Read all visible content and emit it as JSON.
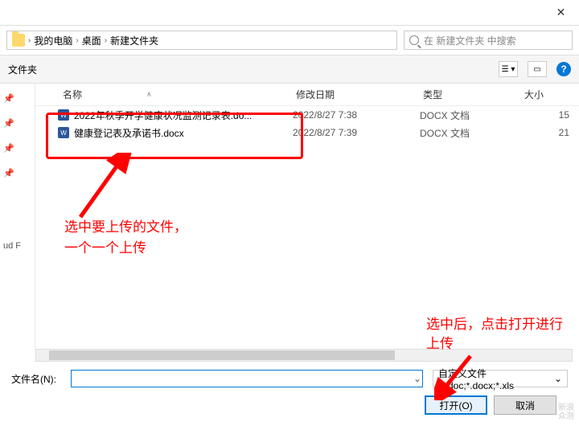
{
  "breadcrumb": {
    "item1": "我的电脑",
    "item2": "桌面",
    "item3": "新建文件夹"
  },
  "search": {
    "placeholder": "在 新建文件夹 中搜索"
  },
  "toolbar": {
    "folder_label": "文件夹",
    "help": "?"
  },
  "columns": {
    "name": "名称",
    "date": "修改日期",
    "type": "类型",
    "size": "大小"
  },
  "files": [
    {
      "name": "2022年秋季开学健康状况监测记录表.do...",
      "date": "2022/8/27 7:38",
      "type": "DOCX 文档",
      "size": "15"
    },
    {
      "name": "健康登记表及承诺书.docx",
      "date": "2022/8/27 7:39",
      "type": "DOCX 文档",
      "size": "21"
    }
  ],
  "sidebar": {
    "item_cloud": "ud F"
  },
  "annotations": {
    "a1_line1": "选中要上传的文件，",
    "a1_line2": "一个一个上传",
    "a2_line1": "选中后，点击打开进行",
    "a2_line2": "上传"
  },
  "footer": {
    "filename_label": "文件名(N):",
    "filter_text": "自定义文件 (*.doc;*.docx;*.xls",
    "open_btn": "打开(O)",
    "cancel_btn": "取消"
  },
  "watermark": {
    "l1": "新浪",
    "l2": "众测"
  }
}
